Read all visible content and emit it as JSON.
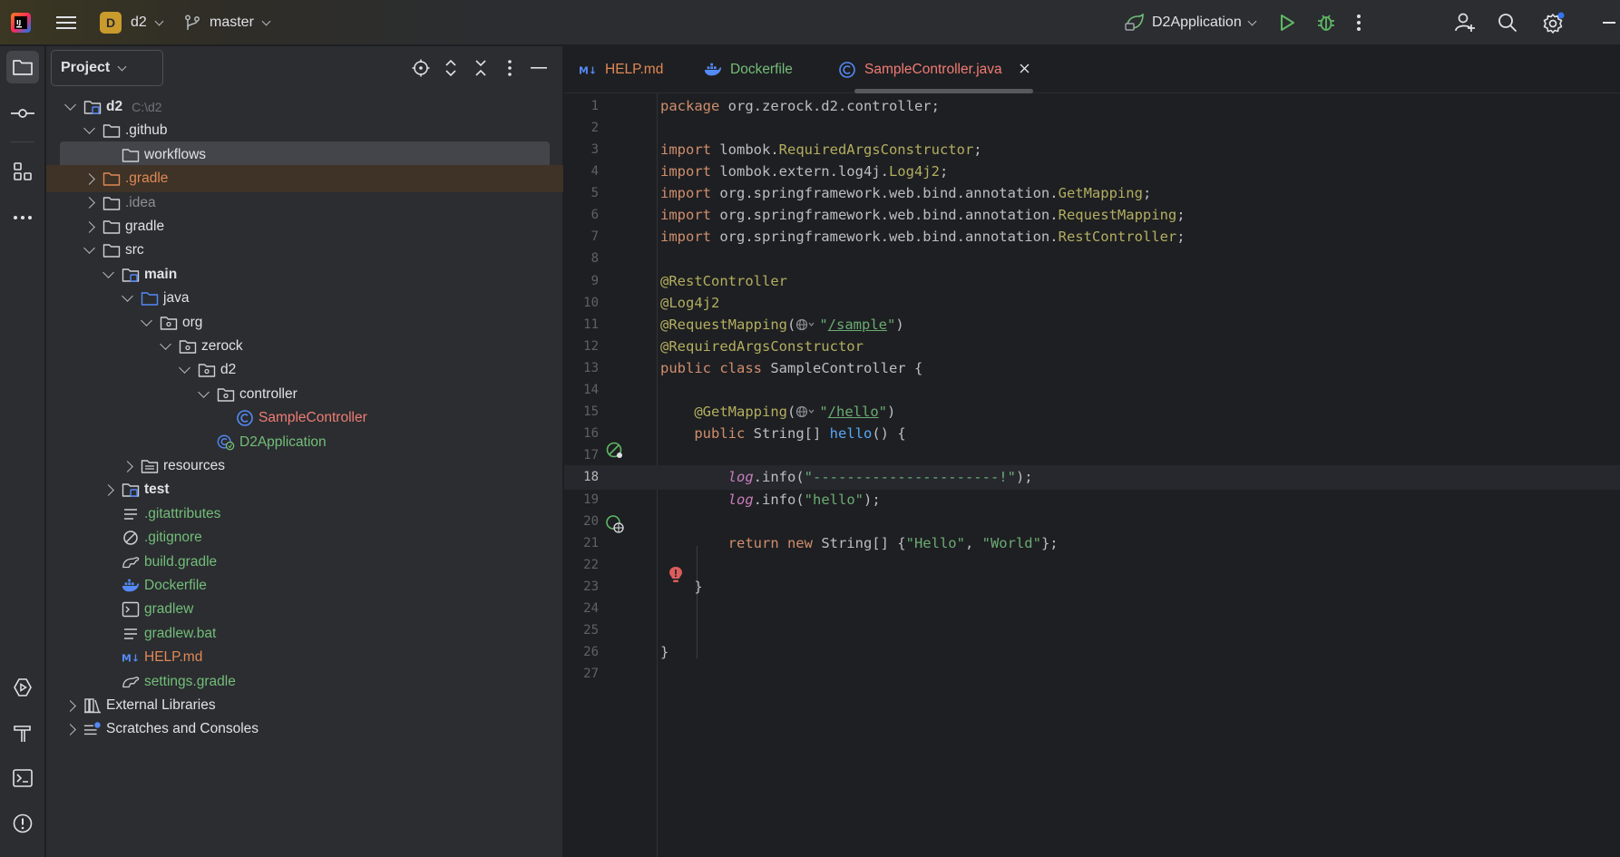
{
  "titlebar": {
    "project_badge": "D",
    "project_name": "d2",
    "branch": "master",
    "run_config": "D2Application"
  },
  "project_panel": {
    "title": "Project",
    "tree": [
      {
        "label": "d2",
        "hint": "C:\\d2",
        "indent": 0,
        "chev": "down",
        "icon": "module-folder-icon",
        "color": "white",
        "bold": true
      },
      {
        "label": ".github",
        "indent": 1,
        "chev": "down",
        "icon": "folder-icon",
        "color": "white"
      },
      {
        "label": "workflows",
        "indent": 2,
        "chev": "",
        "icon": "folder-icon",
        "color": "white",
        "selected": true
      },
      {
        "label": ".gradle",
        "indent": 1,
        "chev": "right",
        "icon": "folder-orange-icon",
        "color": "orange",
        "highlight": true
      },
      {
        "label": ".idea",
        "indent": 1,
        "chev": "right",
        "icon": "folder-icon",
        "color": "grey"
      },
      {
        "label": "gradle",
        "indent": 1,
        "chev": "right",
        "icon": "folder-icon",
        "color": "white"
      },
      {
        "label": "src",
        "indent": 1,
        "chev": "down",
        "icon": "folder-icon",
        "color": "white"
      },
      {
        "label": "main",
        "indent": 2,
        "chev": "down",
        "icon": "module-folder-icon",
        "color": "white",
        "bold": true
      },
      {
        "label": "java",
        "indent": 3,
        "chev": "down",
        "icon": "source-folder-icon",
        "color": "white"
      },
      {
        "label": "org",
        "indent": 4,
        "chev": "down",
        "icon": "package-icon",
        "color": "white"
      },
      {
        "label": "zerock",
        "indent": 5,
        "chev": "down",
        "icon": "package-icon",
        "color": "white"
      },
      {
        "label": "d2",
        "indent": 6,
        "chev": "down",
        "icon": "package-icon",
        "color": "white"
      },
      {
        "label": "controller",
        "indent": 7,
        "chev": "down",
        "icon": "package-icon",
        "color": "white"
      },
      {
        "label": "SampleController",
        "indent": 8,
        "chev": "",
        "icon": "class-icon",
        "color": "red"
      },
      {
        "label": "D2Application",
        "indent": 7,
        "chev": "",
        "icon": "spring-class-icon",
        "color": "green"
      },
      {
        "label": "resources",
        "indent": 3,
        "chev": "right",
        "icon": "resources-folder-icon",
        "color": "white"
      },
      {
        "label": "test",
        "indent": 2,
        "chev": "right",
        "icon": "module-folder-icon",
        "color": "white",
        "bold": true
      },
      {
        "label": ".gitattributes",
        "indent": 2,
        "chev": "",
        "icon": "text-file-icon",
        "color": "green"
      },
      {
        "label": ".gitignore",
        "indent": 2,
        "chev": "",
        "icon": "ignore-file-icon",
        "color": "green"
      },
      {
        "label": "build.gradle",
        "indent": 2,
        "chev": "",
        "icon": "gradle-file-icon",
        "color": "green"
      },
      {
        "label": "Dockerfile",
        "indent": 2,
        "chev": "",
        "icon": "docker-icon",
        "color": "green"
      },
      {
        "label": "gradlew",
        "indent": 2,
        "chev": "",
        "icon": "shell-file-icon",
        "color": "green"
      },
      {
        "label": "gradlew.bat",
        "indent": 2,
        "chev": "",
        "icon": "text-file-icon",
        "color": "green"
      },
      {
        "label": "HELP.md",
        "indent": 2,
        "chev": "",
        "icon": "markdown-icon",
        "color": "orange"
      },
      {
        "label": "settings.gradle",
        "indent": 2,
        "chev": "",
        "icon": "gradle-file-icon",
        "color": "green"
      },
      {
        "label": "External Libraries",
        "indent": 0,
        "chev": "right",
        "icon": "libraries-icon",
        "color": "white"
      },
      {
        "label": "Scratches and Consoles",
        "indent": 0,
        "chev": "right",
        "icon": "scratches-icon",
        "color": "white"
      }
    ]
  },
  "editor": {
    "tabs": [
      {
        "label": "HELP.md",
        "icon": "markdown-icon"
      },
      {
        "label": "Dockerfile",
        "icon": "docker-icon"
      },
      {
        "label": "SampleController.java",
        "icon": "class-icon",
        "active": true
      }
    ],
    "current_line": 18,
    "lines": [
      [
        [
          "kw",
          "package "
        ],
        [
          "cls",
          "org.zerock.d2.controller;"
        ]
      ],
      [],
      [
        [
          "kw",
          "import "
        ],
        [
          "cls",
          "lombok."
        ],
        [
          "typ",
          "RequiredArgsConstructor"
        ],
        [
          "cls",
          ";"
        ]
      ],
      [
        [
          "kw",
          "import "
        ],
        [
          "cls",
          "lombok.extern.log4j."
        ],
        [
          "typ",
          "Log4j2"
        ],
        [
          "cls",
          ";"
        ]
      ],
      [
        [
          "kw",
          "import "
        ],
        [
          "cls",
          "org.springframework.web.bind.annotation."
        ],
        [
          "typ",
          "GetMapping"
        ],
        [
          "cls",
          ";"
        ]
      ],
      [
        [
          "kw",
          "import "
        ],
        [
          "cls",
          "org.springframework.web.bind.annotation."
        ],
        [
          "typ",
          "RequestMapping"
        ],
        [
          "cls",
          ";"
        ]
      ],
      [
        [
          "kw",
          "import "
        ],
        [
          "cls",
          "org.springframework.web.bind.annotation."
        ],
        [
          "typ",
          "RestController"
        ],
        [
          "cls",
          ";"
        ]
      ],
      [],
      [
        [
          "ann",
          "@RestController"
        ]
      ],
      [
        [
          "ann",
          "@Log4j2"
        ]
      ],
      [
        [
          "ann",
          "@RequestMapping"
        ],
        [
          "cls",
          "("
        ],
        [
          "globe",
          ""
        ],
        [
          "str",
          "\""
        ],
        [
          "url",
          "/sample"
        ],
        [
          "str",
          "\""
        ],
        [
          "cls",
          ")"
        ]
      ],
      [
        [
          "ann",
          "@RequiredArgsConstructor"
        ]
      ],
      [
        [
          "kw",
          "public class "
        ],
        [
          "cls",
          "SampleController {"
        ]
      ],
      [],
      [
        [
          "cls",
          "    "
        ],
        [
          "ann",
          "@GetMapping"
        ],
        [
          "cls",
          "("
        ],
        [
          "globe",
          ""
        ],
        [
          "str",
          "\""
        ],
        [
          "url",
          "/hello"
        ],
        [
          "str",
          "\""
        ],
        [
          "cls",
          ")"
        ]
      ],
      [
        [
          "cls",
          "    "
        ],
        [
          "kw",
          "public "
        ],
        [
          "cls",
          "String[] "
        ],
        [
          "fn",
          "hello"
        ],
        [
          "cls",
          "() {"
        ]
      ],
      [],
      [
        [
          "cls",
          "        "
        ],
        [
          "fld",
          "log"
        ],
        [
          "cls",
          ".info("
        ],
        [
          "str",
          "\"----------------------!\""
        ],
        [
          "cls",
          ");"
        ]
      ],
      [
        [
          "cls",
          "        "
        ],
        [
          "fld",
          "log"
        ],
        [
          "cls",
          ".info("
        ],
        [
          "str",
          "\"hello\""
        ],
        [
          "cls",
          ");"
        ]
      ],
      [],
      [
        [
          "cls",
          "        "
        ],
        [
          "kw",
          "return new "
        ],
        [
          "cls",
          "String[] {"
        ],
        [
          "str",
          "\"Hello\""
        ],
        [
          "cls",
          ", "
        ],
        [
          "str",
          "\"World\""
        ],
        [
          "cls",
          "};"
        ]
      ],
      [],
      [
        [
          "cls",
          "    }"
        ]
      ],
      [],
      [],
      [
        [
          "cls",
          "}"
        ]
      ],
      []
    ]
  }
}
